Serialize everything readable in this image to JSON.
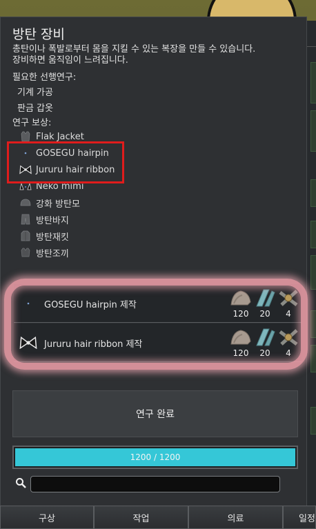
{
  "panel": {
    "title": "방탄 장비",
    "description": "총탄이나 폭발로부터 몸을 지킬 수 있는 복장을 만들 수 있습니다. 장비하면 움직임이 느려집니다.",
    "prerequisites_label": "필요한 선행연구:",
    "prerequisites": [
      "기계 가공",
      "판금 갑옷"
    ],
    "rewards_label": "연구 보상:",
    "rewards": [
      {
        "label": "Flak Jacket",
        "icon": "vest-icon"
      },
      {
        "label": "GOSEGU hairpin",
        "icon": "hairpin-icon"
      },
      {
        "label": "Jururu hair ribbon",
        "icon": "ribbon-icon"
      },
      {
        "label": "Neko mimi",
        "icon": "cat-ears-icon"
      },
      {
        "label": "강화 방탄모",
        "icon": "helmet-icon"
      },
      {
        "label": "방탄바지",
        "icon": "pants-icon"
      },
      {
        "label": "방탄재킷",
        "icon": "jacket-icon"
      },
      {
        "label": "방탄조끼",
        "icon": "vest-icon"
      }
    ],
    "bills": [
      {
        "label": "GOSEGU hairpin 제작",
        "icon": "hairpin-icon",
        "costs": [
          "120",
          "20",
          "4"
        ]
      },
      {
        "label": "Jururu hair ribbon 제작",
        "icon": "ribbon-icon",
        "costs": [
          "120",
          "20",
          "4"
        ]
      }
    ],
    "cost_icons": [
      "cloth-icon",
      "plasteel-icon",
      "component-icon"
    ],
    "complete_button": "연구 완료",
    "progress": {
      "text": "1200 / 1200",
      "fraction": 1.0
    },
    "search": {
      "value": "",
      "placeholder": ""
    }
  },
  "tabs": [
    "구상",
    "작업",
    "의료",
    "일정"
  ],
  "colors": {
    "highlight": "#e01c1c",
    "progress": "#35c7d7",
    "glow": "#f0a0aa"
  }
}
